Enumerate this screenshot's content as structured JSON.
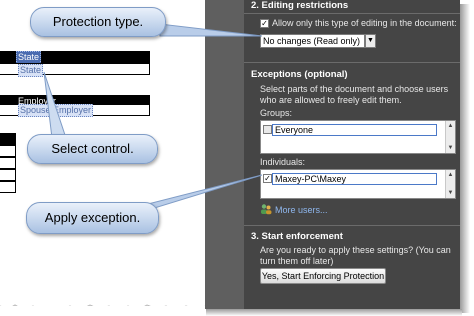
{
  "document": {
    "state_header": "State",
    "state_control": "State",
    "employer_header": "Employer",
    "employer_control": "Spouse Employer"
  },
  "panel": {
    "editing_title": "2. Editing restrictions",
    "allow_checkbox_label": "Allow only this type of editing in the document:",
    "allow_checked": true,
    "editing_type_value": "No changes (Read only)",
    "exceptions_title": "Exceptions (optional)",
    "exceptions_desc": "Select parts of the document and choose users who are allowed to freely edit them.",
    "groups_label": "Groups:",
    "groups": [
      {
        "name": "Everyone",
        "checked": false
      }
    ],
    "individuals_label": "Individuals:",
    "individuals": [
      {
        "name": "Maxey-PC\\Maxey",
        "checked": true
      }
    ],
    "more_users_link": "More users...",
    "enforcement_title": "3. Start enforcement",
    "enforcement_desc": "Are you ready to apply these settings? (You can turn them off later)",
    "enforce_button": "Yes, Start Enforcing Protection"
  },
  "callouts": {
    "protection_type": "Protection type.",
    "select_control": "Select control.",
    "apply_exception": "Apply exception."
  },
  "colors": {
    "panel_bg": "#454545",
    "strip_bg": "#5f5f5f",
    "link": "#8fb7ee",
    "callout_fill": "#cddcf0",
    "callout_border": "#7f9cc6"
  }
}
